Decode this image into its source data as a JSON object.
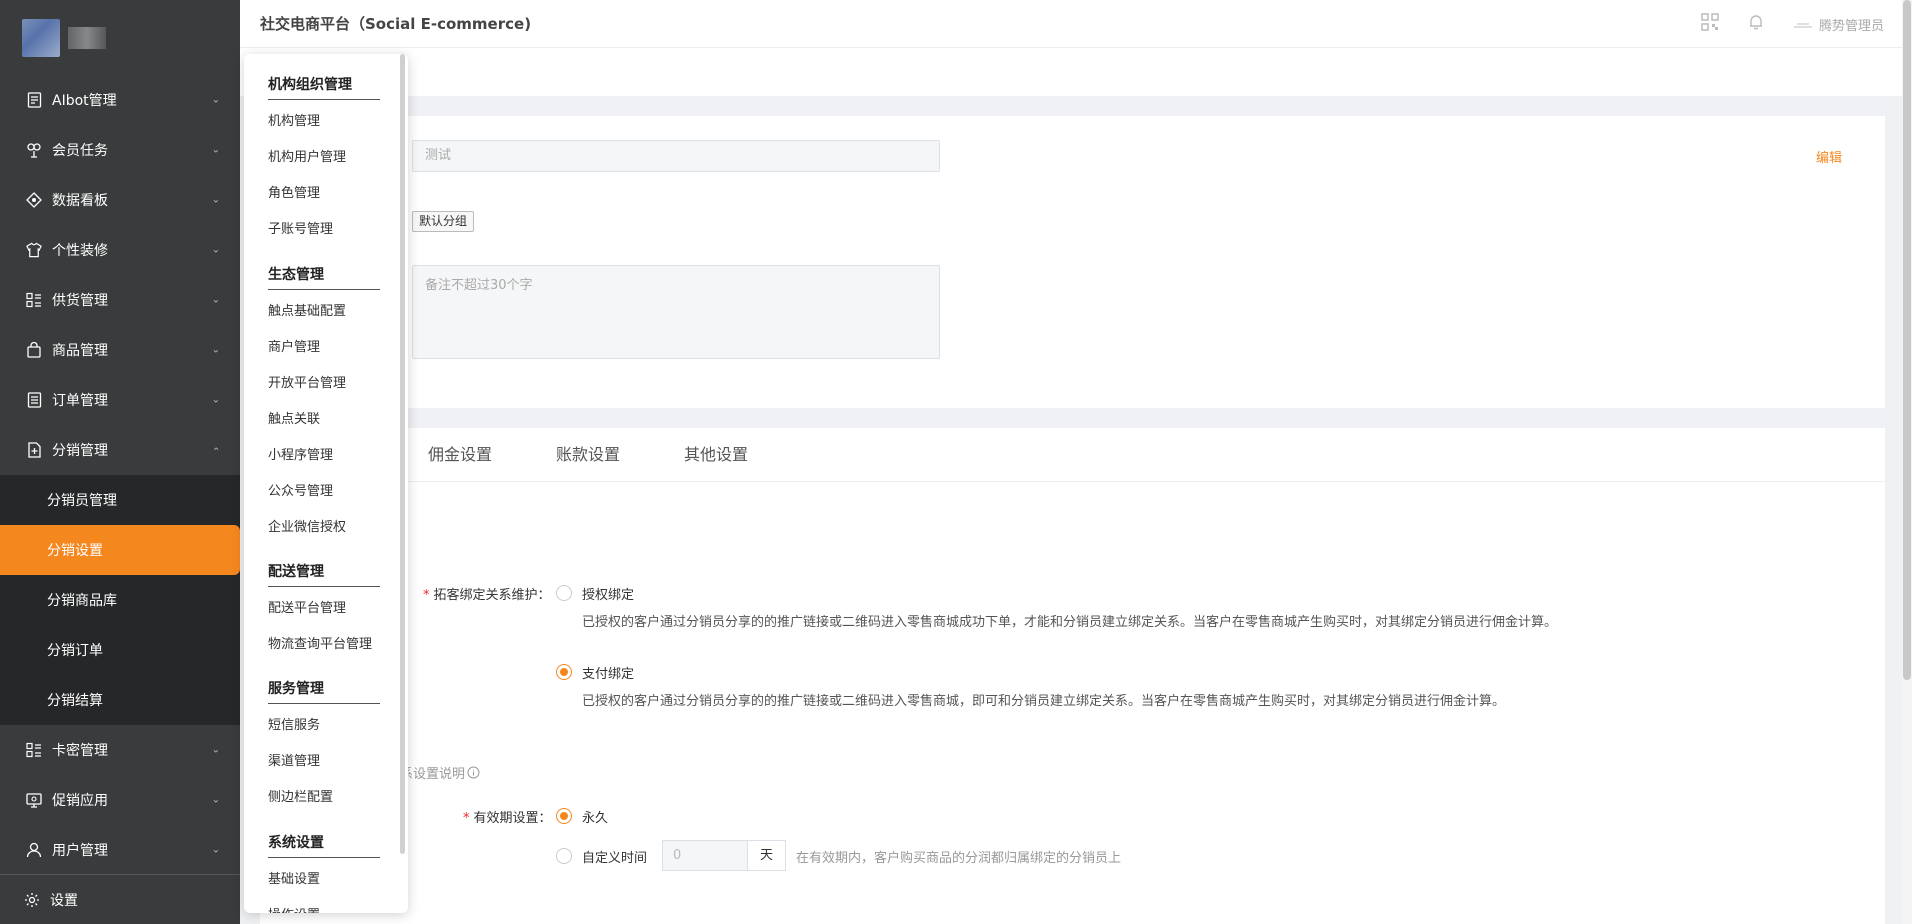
{
  "header": {
    "title": "社交电商平台（Social E-commerce)",
    "user": "腾势管理员",
    "qr_icon": "qrcode-icon",
    "bell_icon": "bell-icon"
  },
  "sidebar": {
    "items": [
      {
        "label": "AIbot管理",
        "icon": "document-icon"
      },
      {
        "label": "会员任务",
        "icon": "people-icon"
      },
      {
        "label": "数据看板",
        "icon": "diamond-icon"
      },
      {
        "label": "个性装修",
        "icon": "tshirt-icon"
      },
      {
        "label": "供货管理",
        "icon": "list-icon"
      },
      {
        "label": "商品管理",
        "icon": "bag-icon"
      },
      {
        "label": "订单管理",
        "icon": "clipboard-icon"
      },
      {
        "label": "分销管理",
        "icon": "plus-doc-icon"
      }
    ],
    "subitems": [
      "分销员管理",
      "分销设置",
      "分销商品库",
      "分销订单",
      "分销结算"
    ],
    "items_after": [
      {
        "label": "卡密管理",
        "icon": "list-icon"
      },
      {
        "label": "促销应用",
        "icon": "monitor-icon"
      },
      {
        "label": "用户管理",
        "icon": "user-icon"
      }
    ],
    "footer": "设置"
  },
  "dropdown": {
    "groups": [
      {
        "title": "机构组织管理",
        "items": [
          "机构管理",
          "机构用户管理",
          "角色管理",
          "子账号管理"
        ]
      },
      {
        "title": "生态管理",
        "items": [
          "触点基础配置",
          "商户管理",
          "开放平台管理",
          "触点关联",
          "小程序管理",
          "公众号管理",
          "企业微信授权"
        ]
      },
      {
        "title": "配送管理",
        "items": [
          "配送平台管理",
          "物流查询平台管理"
        ]
      },
      {
        "title": "服务管理",
        "items": [
          "短信服务",
          "渠道管理",
          "侧边栏配置"
        ]
      },
      {
        "title": "系统设置",
        "items": [
          "基础设置",
          "操作设置"
        ]
      }
    ]
  },
  "card1": {
    "name_value": "测试",
    "group_tag": "默认分组",
    "remark_placeholder": "备注不超过30个字",
    "edit": "编辑"
  },
  "tabs": [
    "佣金设置",
    "账款设置",
    "其他设置"
  ],
  "binding": {
    "label": "拓客绑定关系维护：",
    "option1": "授权绑定",
    "option1_desc": "已授权的客户通过分销员分享的的推广链接或二维码进入零售商城成功下单，才能和分销员建立绑定关系。当客户在零售商城产生购买时，对其绑定分销员进行佣金计算。",
    "option2": "支付绑定",
    "option2_desc": "已授权的客户通过分销员分享的的推广链接或二维码进入零售商城，即可和分销员建立绑定关系。当客户在零售商城产生购买时，对其绑定分销员进行佣金计算。",
    "selected": "支付绑定"
  },
  "settings_note": "系设置说明",
  "validity": {
    "label": "有效期设置：",
    "option1": "永久",
    "option2": "自定义时间",
    "days_value": "0",
    "days_unit": "天",
    "hint": "在有效期内，客户购买商品的分润都归属绑定的分销员上",
    "selected": "永久"
  },
  "colors": {
    "accent": "#f5871f",
    "sidebar_bg": "#3a3b3c",
    "submenu_bg": "#262728"
  }
}
